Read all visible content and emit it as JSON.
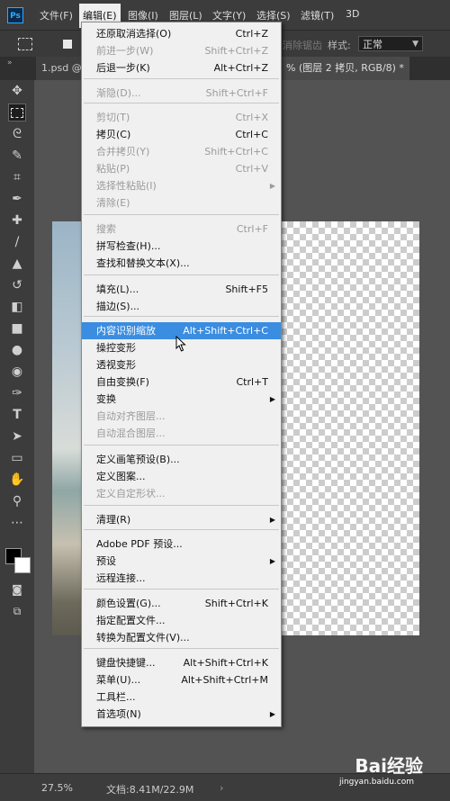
{
  "app": {
    "logo": "Ps"
  },
  "menubar": {
    "items": [
      "文件(F)",
      "编辑(E)",
      "图像(I)",
      "图层(L)",
      "文字(Y)",
      "选择(S)",
      "滤镜(T)",
      "3D"
    ]
  },
  "options": {
    "smooth_label": "消除锯齿",
    "style_label": "样式:",
    "style_value": "正常"
  },
  "tabs": {
    "tab1": "1.psd @",
    "tab2": "% (图层 2 拷贝, RGB/8) *"
  },
  "status": {
    "zoom": "27.5%",
    "doc": "文档:8.41M/22.9M"
  },
  "watermark": {
    "brand": "Bai经验",
    "url": "jingyan.baidu.com"
  },
  "edit_menu": {
    "items": [
      {
        "label": "还原取消选择(O)",
        "shortcut": "Ctrl+Z"
      },
      {
        "label": "前进一步(W)",
        "shortcut": "Shift+Ctrl+Z"
      },
      {
        "label": "后退一步(K)",
        "shortcut": "Alt+Ctrl+Z"
      },
      {
        "label": "渐隐(D)...",
        "shortcut": "Shift+Ctrl+F"
      },
      {
        "label": "剪切(T)",
        "shortcut": "Ctrl+X"
      },
      {
        "label": "拷贝(C)",
        "shortcut": "Ctrl+C"
      },
      {
        "label": "合并拷贝(Y)",
        "shortcut": "Shift+Ctrl+C"
      },
      {
        "label": "粘贴(P)",
        "shortcut": "Ctrl+V"
      },
      {
        "label": "选择性粘贴(I)",
        "shortcut": ""
      },
      {
        "label": "清除(E)",
        "shortcut": ""
      },
      {
        "label": "搜索",
        "shortcut": "Ctrl+F"
      },
      {
        "label": "拼写检查(H)...",
        "shortcut": ""
      },
      {
        "label": "查找和替换文本(X)...",
        "shortcut": ""
      },
      {
        "label": "填充(L)...",
        "shortcut": "Shift+F5"
      },
      {
        "label": "描边(S)...",
        "shortcut": ""
      },
      {
        "label": "内容识别缩放",
        "shortcut": "Alt+Shift+Ctrl+C"
      },
      {
        "label": "操控变形",
        "shortcut": ""
      },
      {
        "label": "透视变形",
        "shortcut": ""
      },
      {
        "label": "自由变换(F)",
        "shortcut": "Ctrl+T"
      },
      {
        "label": "变换",
        "shortcut": ""
      },
      {
        "label": "自动对齐图层...",
        "shortcut": ""
      },
      {
        "label": "自动混合图层...",
        "shortcut": ""
      },
      {
        "label": "定义画笔预设(B)...",
        "shortcut": ""
      },
      {
        "label": "定义图案...",
        "shortcut": ""
      },
      {
        "label": "定义自定形状...",
        "shortcut": ""
      },
      {
        "label": "清理(R)",
        "shortcut": ""
      },
      {
        "label": "Adobe PDF 预设...",
        "shortcut": ""
      },
      {
        "label": "预设",
        "shortcut": ""
      },
      {
        "label": "远程连接...",
        "shortcut": ""
      },
      {
        "label": "颜色设置(G)...",
        "shortcut": "Shift+Ctrl+K"
      },
      {
        "label": "指定配置文件...",
        "shortcut": ""
      },
      {
        "label": "转换为配置文件(V)...",
        "shortcut": ""
      },
      {
        "label": "键盘快捷键...",
        "shortcut": "Alt+Shift+Ctrl+K"
      },
      {
        "label": "菜单(U)...",
        "shortcut": "Alt+Shift+Ctrl+M"
      },
      {
        "label": "工具栏...",
        "shortcut": ""
      },
      {
        "label": "首选项(N)",
        "shortcut": ""
      }
    ]
  }
}
